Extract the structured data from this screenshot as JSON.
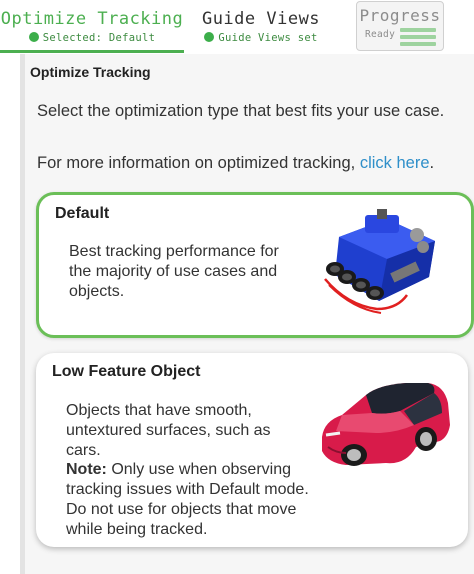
{
  "tabs": {
    "optimize": {
      "title": "Optimize Tracking",
      "subtitle": "Selected: Default"
    },
    "guide": {
      "title": "Guide Views",
      "subtitle": "Guide Views set"
    },
    "progress": {
      "title": "Progress",
      "subtitle": "Ready"
    }
  },
  "main": {
    "section_title": "Optimize Tracking",
    "intro": "Select the optimization type that best fits your use case.",
    "info_prefix": "For more information on optimized tracking, ",
    "info_link": "click here",
    "info_suffix": "."
  },
  "options": [
    {
      "title": "Default",
      "description": "Best tracking performance for the majority of use cases and objects.",
      "image": "engine-model-icon",
      "selected": true
    },
    {
      "title": "Low Feature Object",
      "description": "Objects that have smooth, untextured surfaces, such as cars.",
      "note_label": "Note:",
      "note_text": " Only use when observing tracking issues with Default mode. Do not use for objects that move while being tracked.",
      "image": "car-model-icon",
      "selected": false
    }
  ],
  "colors": {
    "accent_green": "#4caf50",
    "link_blue": "#2f8fc9",
    "selected_border": "#6bbf58"
  }
}
